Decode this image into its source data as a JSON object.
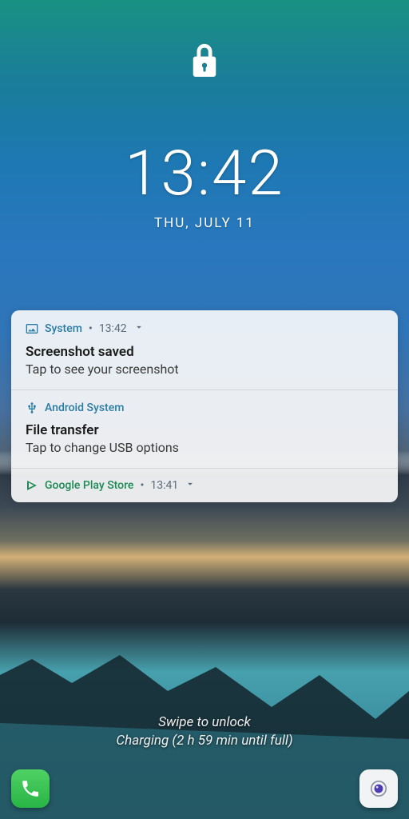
{
  "lockscreen": {
    "time": "13:42",
    "date": "THU, JULY 11",
    "swipe_hint": "Swipe to unlock",
    "charging_status": "Charging (2 h 59 min until full)"
  },
  "notifications": [
    {
      "app": "System",
      "time": "13:42",
      "app_color": "#2a7ca3",
      "icon": "image-icon",
      "title": "Screenshot saved",
      "body": "Tap to see your screenshot",
      "expandable": true
    },
    {
      "app": "Android System",
      "app_color": "#2a7ca3",
      "icon": "usb-icon",
      "title": "File transfer",
      "body": "Tap to change USB options",
      "expandable": false
    },
    {
      "app": "Google Play Store",
      "time": "13:41",
      "app_color": "#1d8a55",
      "icon": "play-store-icon",
      "collapsed": true,
      "expandable": true
    }
  ],
  "shortcuts": {
    "phone_label": "Phone",
    "camera_label": "Camera"
  }
}
